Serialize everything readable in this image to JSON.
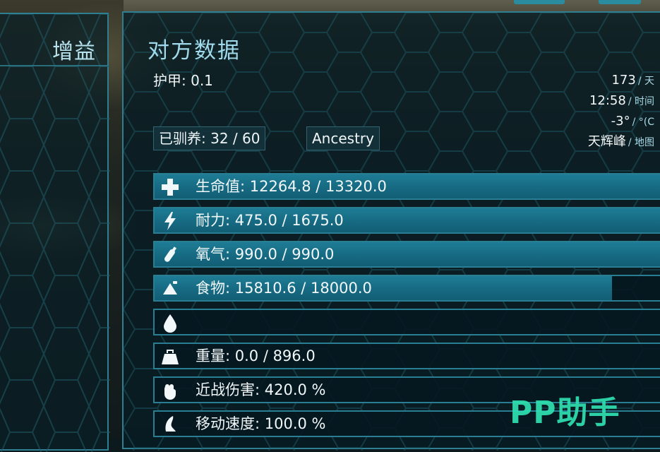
{
  "left_panel": {
    "title": "增益"
  },
  "panel": {
    "title": "对方数据",
    "armor": "护甲: 0.1",
    "tamed": "已驯养: 32 / 60",
    "ancestry": "Ancestry"
  },
  "world_info": [
    {
      "value": "173",
      "unit": "/ 天"
    },
    {
      "value": "12:58",
      "unit": "/ 时间"
    },
    {
      "value": "-3°",
      "unit": "/ °(C"
    },
    {
      "value": "天辉峰",
      "unit": "/ 地图"
    }
  ],
  "stats": [
    {
      "name": "health",
      "icon": "health-cross-icon",
      "text": "生命值: 12264.8 / 13320.0",
      "fill": 1.0
    },
    {
      "name": "stamina",
      "icon": "lightning-icon",
      "text": "耐力: 475.0 / 1675.0",
      "fill": 1.0
    },
    {
      "name": "oxygen",
      "icon": "oxygen-tank-icon",
      "text": "氧气: 990.0 / 990.0",
      "fill": 1.0
    },
    {
      "name": "food",
      "icon": "food-icon",
      "text": "食物: 15810.6 / 18000.0",
      "fill": 0.88
    },
    {
      "name": "water",
      "icon": "water-drop-icon",
      "text": "",
      "fill": 0.0
    },
    {
      "name": "weight",
      "icon": "weight-icon",
      "text": "重量: 0.0 / 896.0",
      "fill": 0.0
    },
    {
      "name": "melee",
      "icon": "fist-icon",
      "text": "近战伤害: 420.0 %",
      "fill": 0.0
    },
    {
      "name": "speed",
      "icon": "foot-icon",
      "text": "移动速度: 100.0 %",
      "fill": 0.0
    }
  ],
  "watermark": "PP助手",
  "colors": {
    "accent": "#2e7f92",
    "fill": "#1e7c95",
    "watermark": "#2fe0b0"
  }
}
